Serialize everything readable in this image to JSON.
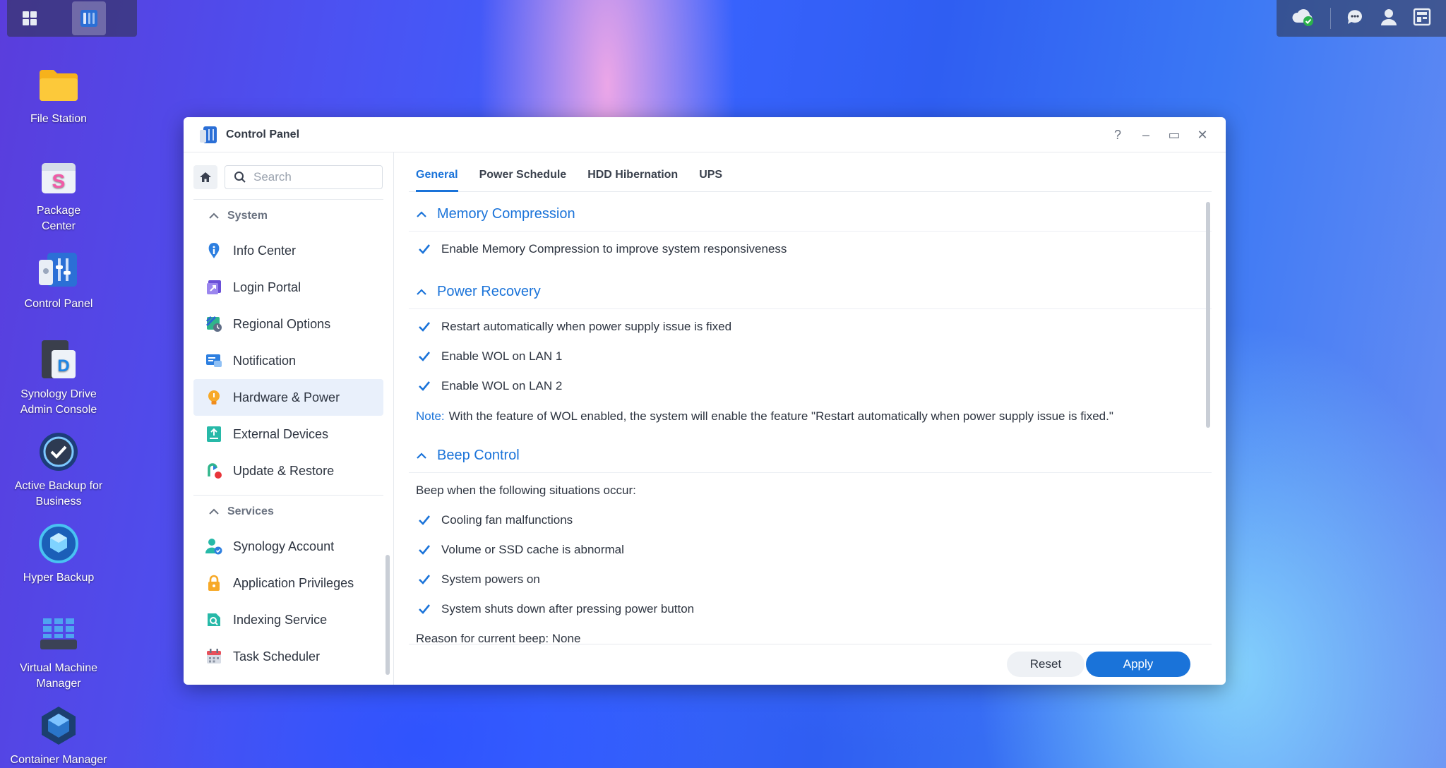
{
  "desktop": {
    "icons": [
      {
        "label": "File Station"
      },
      {
        "label": "Package Center"
      },
      {
        "label": "Control Panel"
      },
      {
        "label": "Synology Drive Admin Console"
      },
      {
        "label": "Active Backup for Business"
      },
      {
        "label": "Hyper Backup"
      },
      {
        "label": "Virtual Machine Manager"
      },
      {
        "label": "Container Manager"
      }
    ]
  },
  "window": {
    "title": "Control Panel",
    "controls": {
      "help": "?",
      "minimize": "–",
      "maximize": "▭",
      "close": "✕"
    }
  },
  "sidebar": {
    "search_placeholder": "Search",
    "groups": [
      {
        "label": "System",
        "items": [
          {
            "label": "Info Center"
          },
          {
            "label": "Login Portal"
          },
          {
            "label": "Regional Options"
          },
          {
            "label": "Notification"
          },
          {
            "label": "Hardware & Power",
            "active": true
          },
          {
            "label": "External Devices"
          },
          {
            "label": "Update & Restore"
          }
        ]
      },
      {
        "label": "Services",
        "items": [
          {
            "label": "Synology Account"
          },
          {
            "label": "Application Privileges"
          },
          {
            "label": "Indexing Service"
          },
          {
            "label": "Task Scheduler"
          }
        ]
      }
    ]
  },
  "tabs": [
    {
      "label": "General",
      "active": true
    },
    {
      "label": "Power Schedule"
    },
    {
      "label": "HDD Hibernation"
    },
    {
      "label": "UPS"
    }
  ],
  "sections": {
    "memory": {
      "title": "Memory Compression",
      "options": [
        {
          "label": "Enable Memory Compression to improve system responsiveness",
          "checked": true
        }
      ]
    },
    "power": {
      "title": "Power Recovery",
      "options": [
        {
          "label": "Restart automatically when power supply issue is fixed",
          "checked": true
        },
        {
          "label": "Enable WOL on LAN 1",
          "checked": true
        },
        {
          "label": "Enable WOL on LAN 2",
          "checked": true
        }
      ],
      "note_label": "Note:",
      "note_text": "With the feature of WOL enabled, the system will enable the feature \"Restart automatically when power supply issue is fixed.\""
    },
    "beep": {
      "title": "Beep Control",
      "intro": "Beep when the following situations occur:",
      "options": [
        {
          "label": "Cooling fan malfunctions",
          "checked": true
        },
        {
          "label": "Volume or SSD cache is abnormal",
          "checked": true
        },
        {
          "label": "System powers on",
          "checked": true
        },
        {
          "label": "System shuts down after pressing power button",
          "checked": true
        }
      ],
      "reason": "Reason for current beep: None"
    }
  },
  "footer": {
    "reset": "Reset",
    "apply": "Apply"
  },
  "colors": {
    "accent": "#1a73d9",
    "active_bg": "#e9f0fb"
  }
}
